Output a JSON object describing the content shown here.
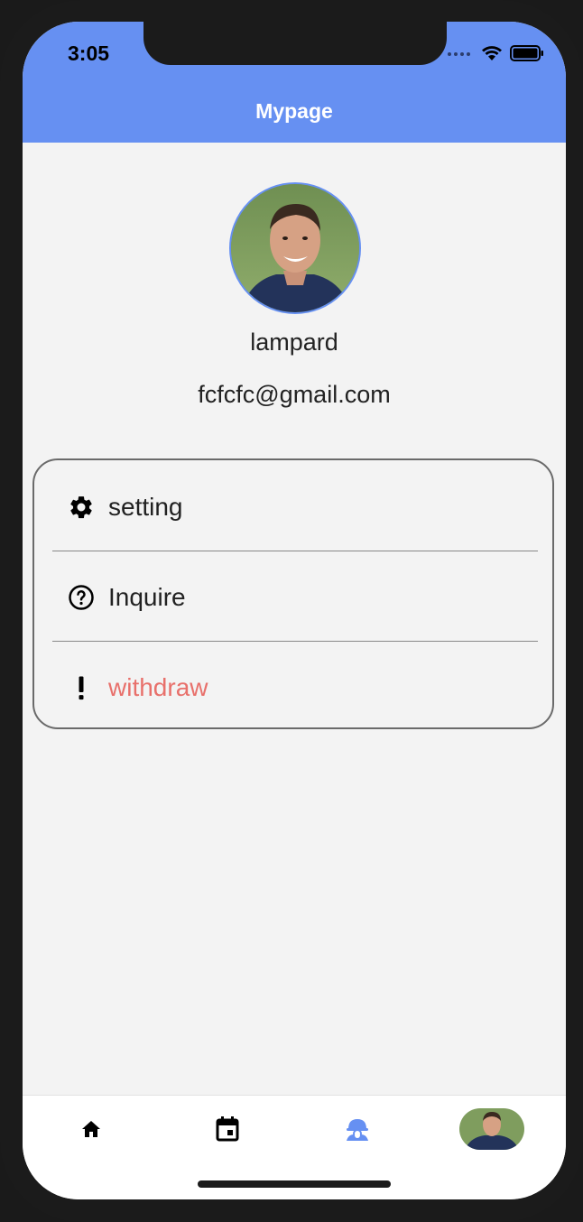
{
  "status_bar": {
    "time": "3:05"
  },
  "header": {
    "title": "Mypage",
    "color": "#6690f2"
  },
  "profile": {
    "username": "lampard",
    "email": "fcfcfc@gmail.com"
  },
  "menu": {
    "items": [
      {
        "label": "setting",
        "icon": "gear-icon",
        "color": "#222222"
      },
      {
        "label": "Inquire",
        "icon": "help-circle-icon",
        "color": "#222222"
      },
      {
        "label": "withdraw",
        "icon": "exclamation-icon",
        "color": "#e8706b"
      }
    ]
  },
  "tab_bar": {
    "tabs": [
      {
        "icon": "home-icon",
        "active": false
      },
      {
        "icon": "calendar-icon",
        "active": false
      },
      {
        "icon": "community-icon",
        "active": true
      },
      {
        "icon": "profile-avatar",
        "active": false
      }
    ]
  }
}
